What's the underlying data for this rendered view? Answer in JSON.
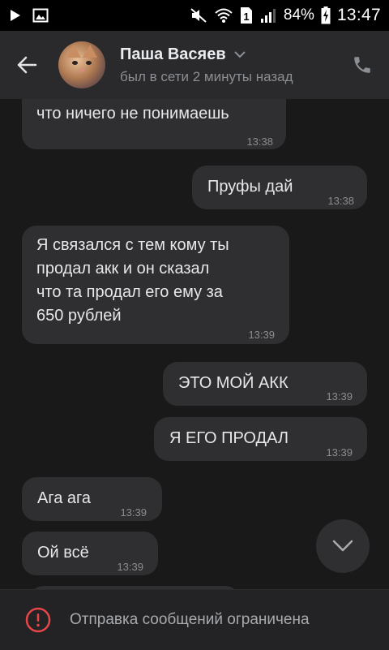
{
  "status_bar": {
    "icons_left": [
      "play-store-icon",
      "image-icon"
    ],
    "icons_right": [
      "mute-icon",
      "wifi-icon",
      "sim-1-icon",
      "signal-icon"
    ],
    "sim": "1",
    "battery": "84%",
    "time": "13:47"
  },
  "header": {
    "name": "Паша Васяев",
    "status": "был в сети 2 минуты назад"
  },
  "messages": [
    {
      "text": "что ничего не понимаешь",
      "time": "13:38",
      "side": "in"
    },
    {
      "text": "Пруфы дай",
      "time": "13:38",
      "side": "out"
    },
    {
      "text": "Я связался с тем кому ты\nпродал акк и он сказал\nчто та продал его ему за\n650 рублей",
      "time": "13:39",
      "side": "in"
    },
    {
      "text": "ЭТО МОЙ АКК",
      "time": "13:39",
      "side": "out"
    },
    {
      "text": "Я ЕГО ПРОДАЛ",
      "time": "13:39",
      "side": "out"
    },
    {
      "text": "Ага ага",
      "time": "13:39",
      "side": "in"
    },
    {
      "text": "Ой всё",
      "time": "13:39",
      "side": "in"
    }
  ],
  "footer": {
    "text": "Отправка сообщений ограничена"
  },
  "colors": {
    "background": "#19191a",
    "header": "#2a2a2c",
    "bubble": "#2f2f31",
    "alert_red": "#e64646"
  }
}
